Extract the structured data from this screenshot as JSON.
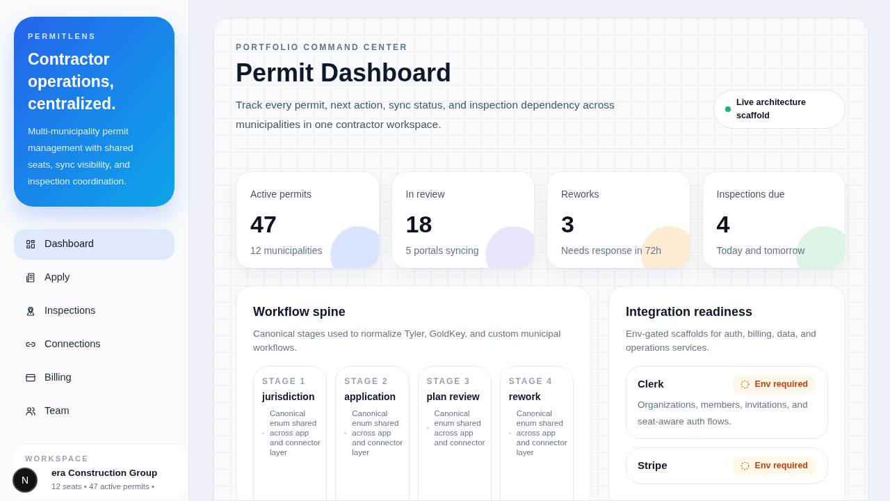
{
  "brand": {
    "eyebrow": "PERMITLENS",
    "headline": "Contractor operations, centralized.",
    "description": "Multi-municipality permit management with shared seats, sync visibility, and inspection coordination."
  },
  "nav": [
    {
      "label": "Dashboard",
      "selected": true
    },
    {
      "label": "Apply",
      "selected": false
    },
    {
      "label": "Inspections",
      "selected": false
    },
    {
      "label": "Connections",
      "selected": false
    },
    {
      "label": "Billing",
      "selected": false
    },
    {
      "label": "Team",
      "selected": false
    }
  ],
  "workspace": {
    "label": "WORKSPACE",
    "name": "era Construction Group",
    "meta": "12 seats • 47 active permits •"
  },
  "dev_badge": "N",
  "header": {
    "eyebrow": "PORTFOLIO COMMAND CENTER",
    "title": "Permit Dashboard",
    "description": "Track every permit, next action, sync status, and inspection dependency across municipalities in one contractor workspace.",
    "status": {
      "label": "Live architecture scaffold",
      "color": "#10b981"
    }
  },
  "stats": [
    {
      "label": "Active permits",
      "value": "47",
      "note": "12 municipalities",
      "color": "#dbe4ff"
    },
    {
      "label": "In review",
      "value": "18",
      "note": "5 portals syncing",
      "color": "#ebe5fc"
    },
    {
      "label": "Reworks",
      "value": "3",
      "note": "Needs response in 72h",
      "color": "#fdebd3"
    },
    {
      "label": "Inspections due",
      "value": "4",
      "note": "Today and tomorrow",
      "color": "#dcf3e6"
    }
  ],
  "workflow": {
    "title": "Workflow spine",
    "description": "Canonical stages used to normalize Tyler, GoldKey, and custom municipal workflows.",
    "stages": [
      {
        "label": "STAGE 1",
        "name": "jurisdiction",
        "points": [
          "Canonical enum shared across app and connector layer"
        ]
      },
      {
        "label": "STAGE 2",
        "name": "application",
        "points": [
          "Canonical enum shared across app and connector layer"
        ]
      },
      {
        "label": "STAGE 3",
        "name": "plan review",
        "points": [
          "Canonical enum shared across app and connector"
        ]
      },
      {
        "label": "STAGE 4",
        "name": "rework",
        "points": [
          "Canonical enum shared across app and connector layer"
        ]
      }
    ]
  },
  "integrations": {
    "title": "Integration readiness",
    "description": "Env-gated scaffolds for auth, billing, data, and operations services.",
    "items": [
      {
        "name": "Clerk",
        "status": "Env required",
        "description": "Organizations, members, invitations, and seat-aware auth flows."
      },
      {
        "name": "Stripe",
        "status": "Env required"
      }
    ]
  }
}
